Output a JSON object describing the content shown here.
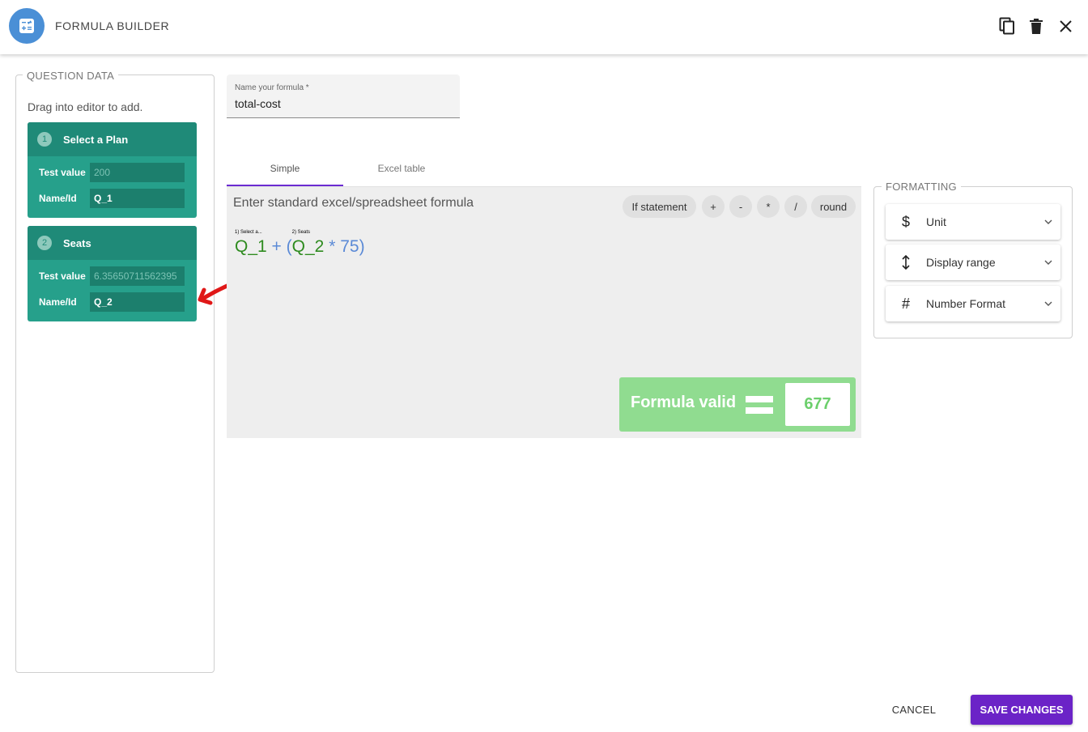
{
  "header": {
    "title": "FORMULA BUILDER",
    "app_icon": "calculator-icon",
    "actions": [
      {
        "name": "duplicate",
        "icon": "copy-icon"
      },
      {
        "name": "delete",
        "icon": "trash-icon"
      },
      {
        "name": "close",
        "icon": "close-icon"
      }
    ]
  },
  "question_data": {
    "legend": "QUESTION DATA",
    "hint": "Drag into editor to add.",
    "questions": [
      {
        "number": "1",
        "title": "Select a Plan",
        "test_value_label": "Test value",
        "test_value": "200",
        "name_label": "Name/Id",
        "name_id": "Q_1"
      },
      {
        "number": "2",
        "title": "Seats",
        "test_value_label": "Test value",
        "test_value": "6.35650711562395",
        "name_label": "Name/Id",
        "name_id": "Q_2"
      }
    ]
  },
  "formula_name": {
    "label": "Name your formula *",
    "value": "total-cost"
  },
  "tabs": [
    {
      "label": "Simple",
      "active": true
    },
    {
      "label": "Excel table",
      "active": false
    }
  ],
  "editor": {
    "hint": "Enter standard excel/spreadsheet formula",
    "chips": [
      "If statement",
      "+",
      "-",
      "*",
      "/",
      "round"
    ],
    "formula": {
      "q1_tip": "1) Select a...",
      "q1_ref": "Q_1",
      "plus": "+",
      "open_paren": "(",
      "q2_tip": "2) Seats",
      "q2_ref": "Q_2",
      "rest": "* 75)"
    },
    "result": {
      "status": "Formula valid",
      "value": "677",
      "color": "#90dc90"
    }
  },
  "formatting": {
    "legend": "FORMATTING",
    "items": [
      {
        "label": "Unit",
        "icon": "dollar-icon"
      },
      {
        "label": "Display range",
        "icon": "vertical-arrows-icon"
      },
      {
        "label": "Number Format",
        "icon": "hash-icon"
      }
    ]
  },
  "footer": {
    "cancel_label": "CANCEL",
    "save_label": "SAVE CHANGES",
    "save_color": "#6b23c7"
  }
}
